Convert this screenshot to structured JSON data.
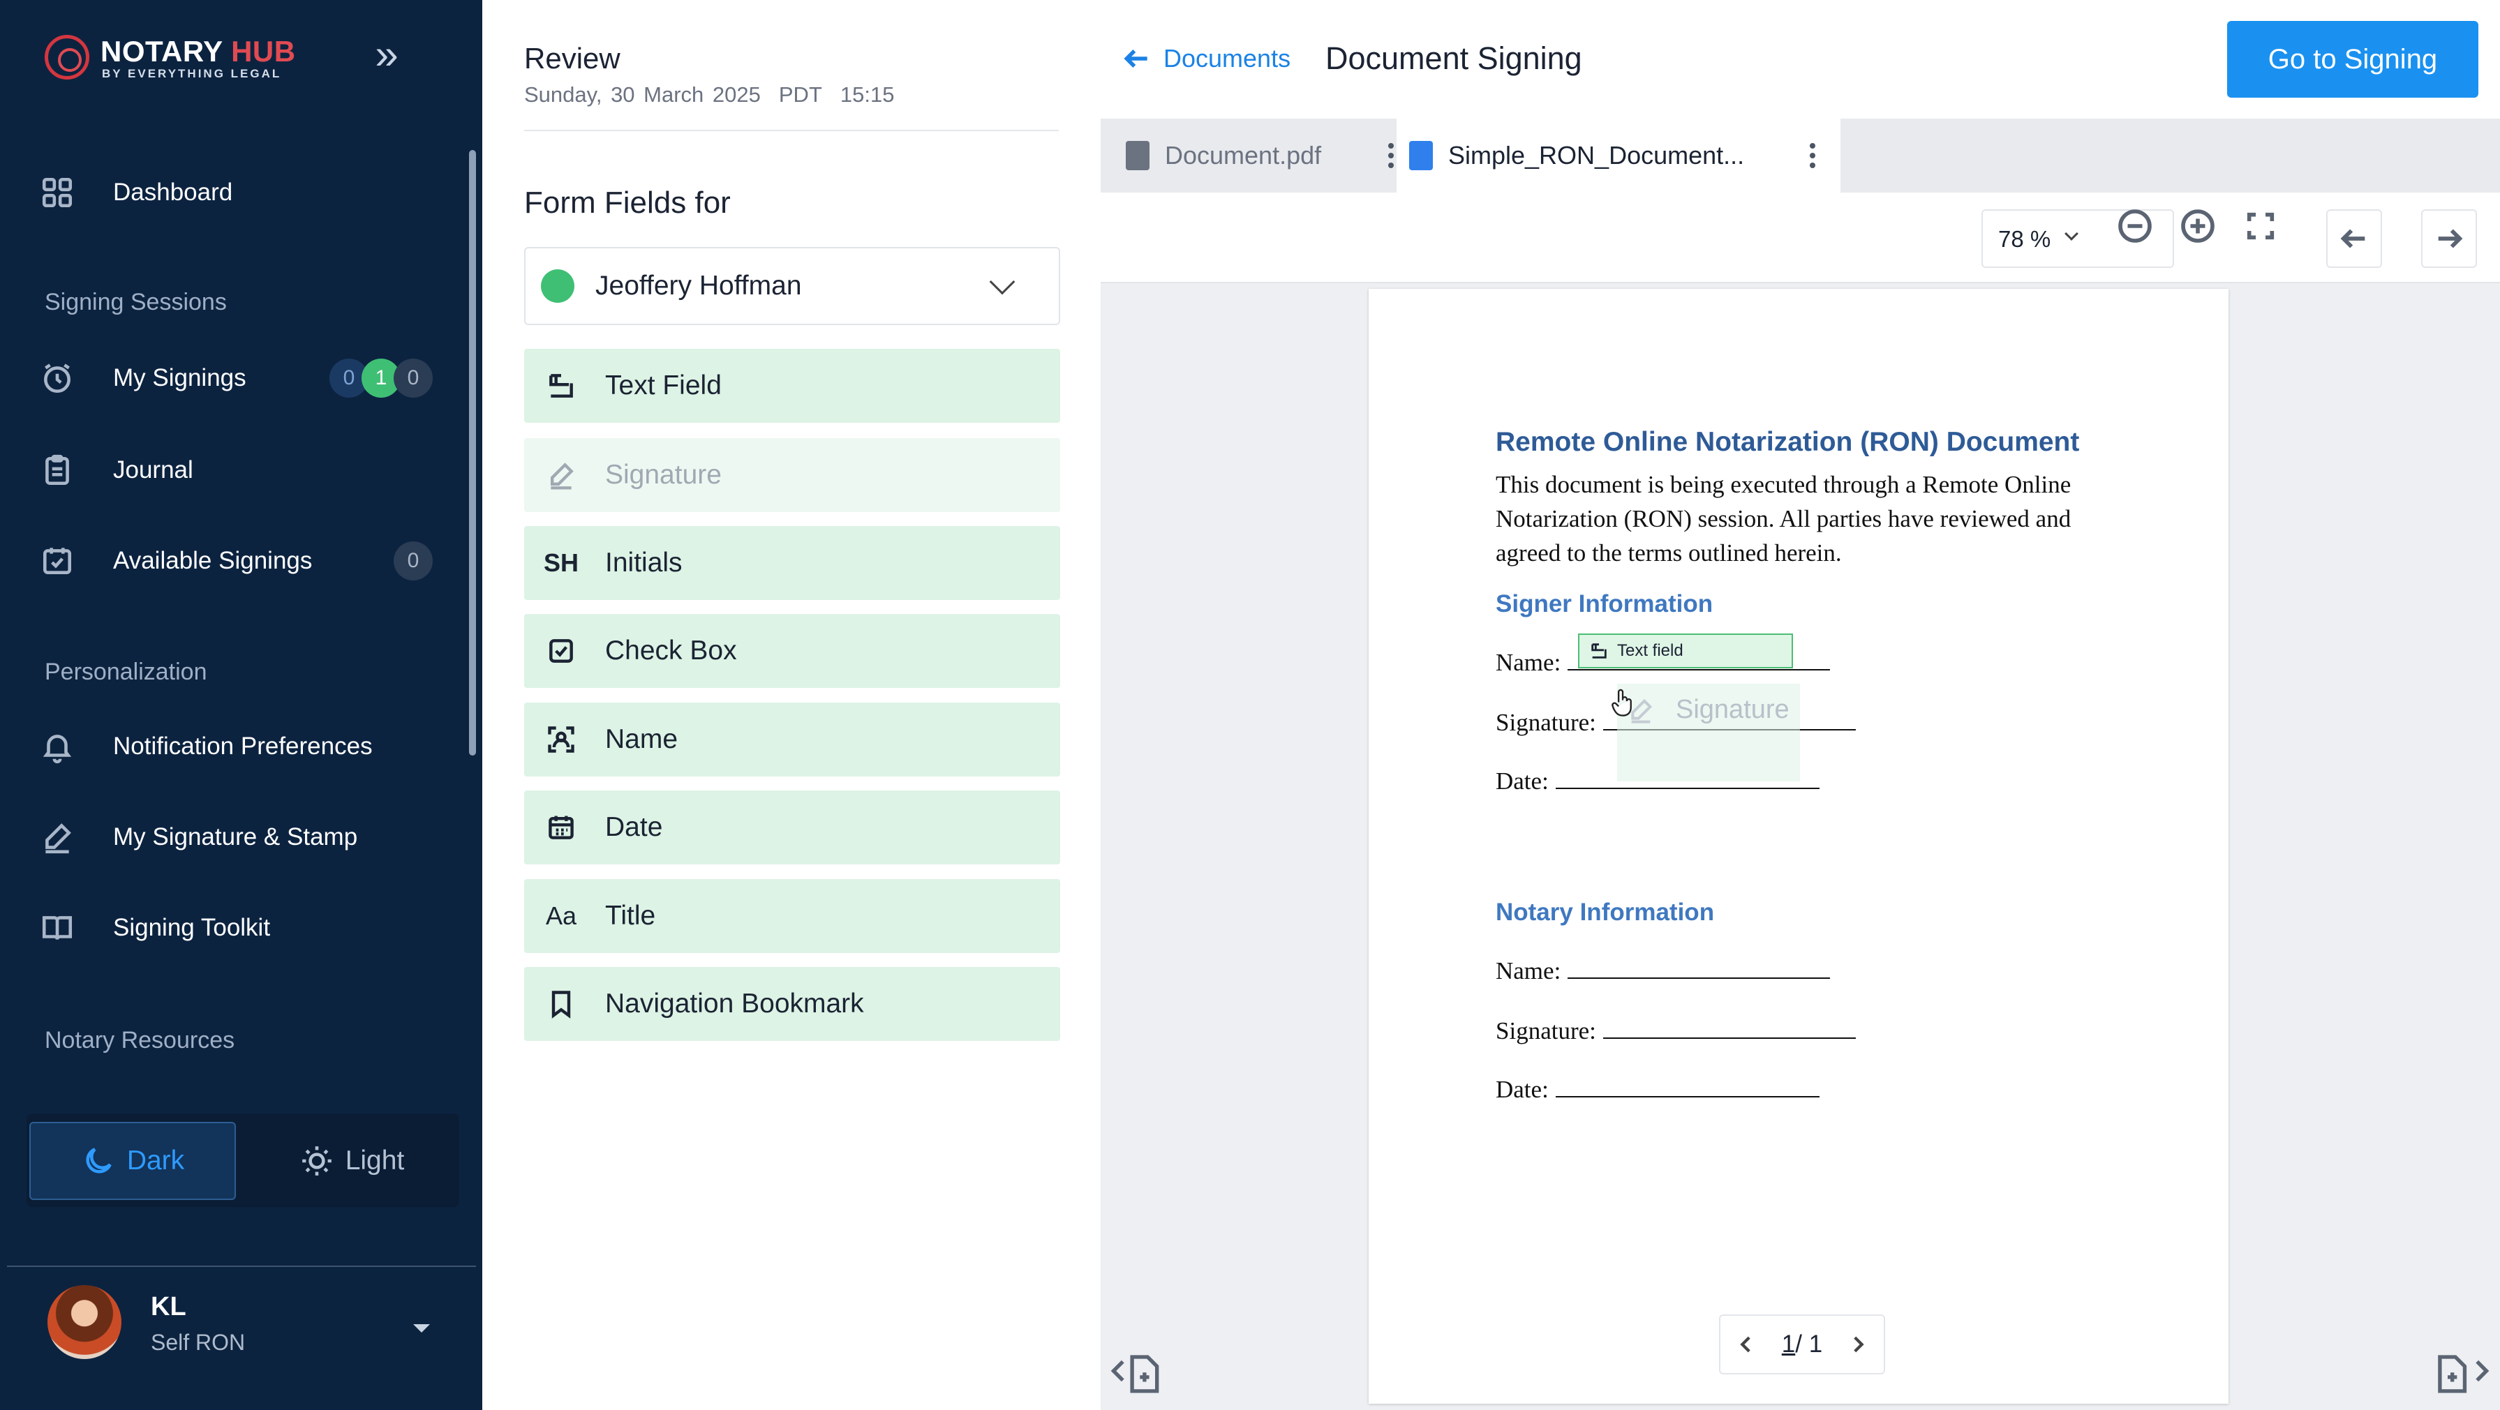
{
  "app": {
    "logo_main": "NOTARY",
    "logo_accent": "HUB",
    "logo_sub": "BY EVERYTHING LEGAL"
  },
  "sidebar": {
    "dashboard": "Dashboard",
    "section_signing": "Signing Sessions",
    "my_signings": "My Signings",
    "my_signings_counts": [
      "0",
      "1",
      "0"
    ],
    "journal": "Journal",
    "available_signings": "Available Signings",
    "available_count": "0",
    "section_personalization": "Personalization",
    "notification_prefs": "Notification Preferences",
    "signature_stamp": "My Signature & Stamp",
    "signing_toolkit": "Signing Toolkit",
    "section_resources": "Notary Resources",
    "theme_dark": "Dark",
    "theme_light": "Light",
    "user_initials": "KL",
    "user_role": "Self RON"
  },
  "review": {
    "title": "Review",
    "date": "Sunday, 30 March 2025",
    "tz": "PDT",
    "time": "15:15",
    "form_fields_label": "Form Fields for",
    "signer": "Jeoffery Hoffman",
    "signer_color": "#3fbf74",
    "fields": {
      "text_field": "Text Field",
      "signature": "Signature",
      "initials": "Initials",
      "initials_icon": "SH",
      "check_box": "Check Box",
      "name": "Name",
      "date": "Date",
      "title": "Title",
      "title_icon": "Aa",
      "nav_bookmark": "Navigation Bookmark"
    }
  },
  "viewer": {
    "back_label": "Documents",
    "title": "Document Signing",
    "go_button": "Go to Signing",
    "tabs": [
      "Document.pdf",
      "Simple_RON_Document..."
    ],
    "zoom": "78 %",
    "page_indicator_current": "1",
    "page_indicator_total": "/ 1"
  },
  "document": {
    "heading": "Remote Online Notarization (RON) Document",
    "intro": "This document is being executed through a Remote Online Notarization (RON) session. All parties have reviewed and agreed to the terms outlined herein.",
    "signer_heading": "Signer Information",
    "notary_heading": "Notary Information",
    "name_label": "Name:",
    "signature_label": "Signature:",
    "date_label": "Date:",
    "overlay_text_field": "Text field",
    "overlay_signature": "Signature"
  },
  "colors": {
    "sidebar_bg": "#0c2340",
    "accent": "#1a91f0",
    "field_bg": "#ddf3e5",
    "doc_heading": "#2e5b97"
  }
}
